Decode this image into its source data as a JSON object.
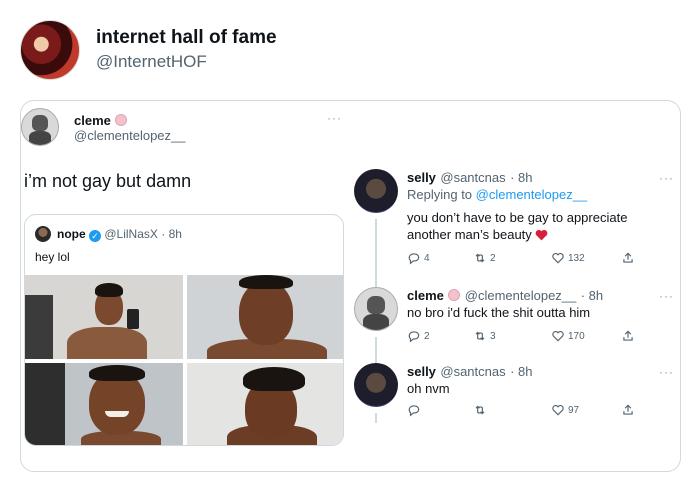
{
  "header": {
    "name": "internet hall of fame",
    "handle": "@InternetHOF"
  },
  "main_tweet": {
    "name": "cleme",
    "handle": "@clementelopez__",
    "text": "i’m not gay but damn",
    "more": "···"
  },
  "quoted_tweet": {
    "name": "nope",
    "handle": "@LilNasX",
    "time": "· 8h",
    "text": "hey lol"
  },
  "replies": [
    {
      "name": "selly",
      "handle": "@santcnas",
      "time": "· 8h",
      "replying_prefix": "Replying to",
      "replying_to": "@clementelopez__",
      "text": "you don’t have to be gay to appreciate another man’s beauty",
      "replies": "4",
      "retweets": "2",
      "likes": "132",
      "more": "···"
    },
    {
      "name": "cleme",
      "handle": "@clementelopez__",
      "time": "· 8h",
      "text": "no bro i'd fuck the shit outta him",
      "replies": "2",
      "retweets": "3",
      "likes": "170",
      "more": "···"
    },
    {
      "name": "selly",
      "handle": "@santcnas",
      "time": "· 8h",
      "text": "oh nvm",
      "replies": "",
      "retweets": "",
      "likes": "97",
      "more": "···"
    }
  ],
  "colors": {
    "accent": "#1d9bf0",
    "text": "#0f1419",
    "muted": "#536471",
    "border": "#cfd9de",
    "heart_emoji": "#d61f3a"
  },
  "icons": [
    "reply-icon",
    "retweet-icon",
    "like-icon",
    "share-icon",
    "more-icon",
    "verified-icon"
  ]
}
